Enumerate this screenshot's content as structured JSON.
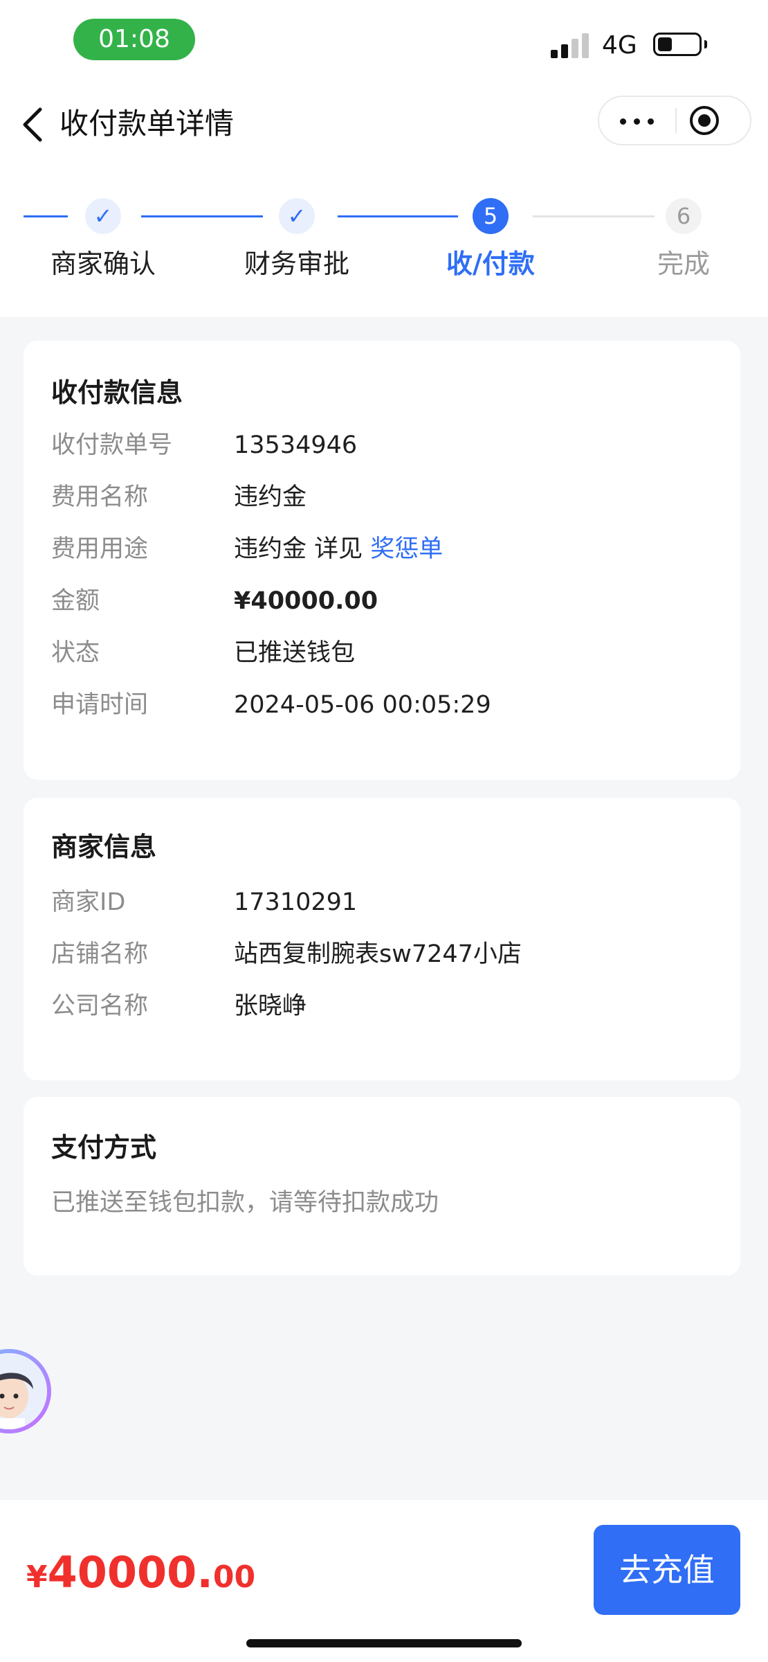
{
  "status_bar": {
    "time": "01:08",
    "network": "4G",
    "pill_color": "#33b24a"
  },
  "nav": {
    "title": "收付款单详情",
    "back_icon": "chevron-left-icon",
    "more_icon": "more-dots-icon",
    "close_icon": "target-circle-icon"
  },
  "steps": [
    {
      "label": "商家确认",
      "state": "done",
      "marker": "✓"
    },
    {
      "label": "财务审批",
      "state": "done",
      "marker": "✓"
    },
    {
      "label": "收/付款",
      "state": "current",
      "marker": "5"
    },
    {
      "label": "完成",
      "state": "future",
      "marker": "6"
    }
  ],
  "payment_info": {
    "title": "收付款信息",
    "rows": [
      {
        "label": "收付款单号",
        "value": "13534946"
      },
      {
        "label": "费用名称",
        "value": "违约金"
      },
      {
        "label": "费用用途",
        "value": "违约金 详见",
        "link": "奖惩单"
      },
      {
        "label": "金额",
        "value": "¥40000.00"
      },
      {
        "label": "状态",
        "value": "已推送钱包"
      },
      {
        "label": "申请时间",
        "value": "2024-05-06 00:05:29"
      }
    ]
  },
  "merchant_info": {
    "title": "商家信息",
    "rows": [
      {
        "label": "商家ID",
        "value": "17310291"
      },
      {
        "label": "店铺名称",
        "value": "站西复制腕表sw7247小店"
      },
      {
        "label": "公司名称",
        "value": "张晓峥"
      }
    ]
  },
  "payment_method": {
    "title": "支付方式",
    "note": "已推送至钱包扣款，请等待扣款成功"
  },
  "footer": {
    "currency": "¥",
    "amount_int": "40000.",
    "amount_dec": "00",
    "button": "去充值"
  },
  "colors": {
    "accent": "#2f6ef5",
    "price": "#f0302c",
    "background": "#f5f6f8"
  }
}
